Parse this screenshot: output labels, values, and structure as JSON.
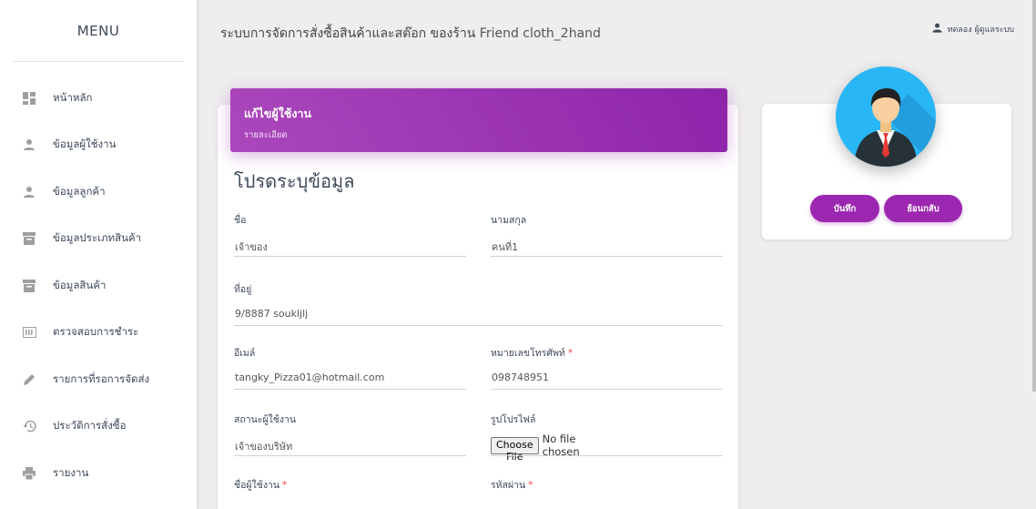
{
  "sidebar": {
    "logo": "MENU",
    "items": [
      {
        "label": "หน้าหลัก",
        "icon": "dashboard-icon"
      },
      {
        "label": "ข้อมูลผู้ใช้งาน",
        "icon": "person-icon"
      },
      {
        "label": "ข้อมูลลูกค้า",
        "icon": "person-icon"
      },
      {
        "label": "ข้อมูลประเภทสินค้า",
        "icon": "archive-icon"
      },
      {
        "label": "ข้อมูลสินค้า",
        "icon": "archive-icon"
      },
      {
        "label": "ตรวจสอบการชำระ",
        "icon": "payment-icon"
      },
      {
        "label": "รายการที่รอการจัดส่ง",
        "icon": "pencil-icon"
      },
      {
        "label": "ประวัติการสั่งซื้อ",
        "icon": "history-icon"
      },
      {
        "label": "รายงาน",
        "icon": "printer-icon"
      }
    ]
  },
  "topbar": {
    "title": "ระบบการจัดการสั่งซื้อสินค้าและสต๊อก ของร้าน",
    "shop_name": "Friend cloth_2hand",
    "user_label": "ทดลอง ผู้ดูแลระบบ"
  },
  "card": {
    "title": "แก้ไขผู้ใช้งาน",
    "subtitle": "รายละเอียด",
    "form_heading": "โปรดระบุข้อมูล"
  },
  "form": {
    "first_name": {
      "label": "ชื่อ",
      "value": "เจ้าของ"
    },
    "last_name": {
      "label": "นามสกุล",
      "value": "คนที่1"
    },
    "address": {
      "label": "ที่อยู่",
      "value": "9/8887 soukljlj"
    },
    "email": {
      "label": "อีเมล์",
      "value": "tangky_Pizza01@hotmail.com"
    },
    "phone": {
      "label": "หมายเลขโทรศัพท์",
      "required": "*",
      "value": "098748951"
    },
    "status": {
      "label": "สถานะผู้ใช้งาน",
      "value": "เจ้าของบริษัท"
    },
    "profile_picture": {
      "label": "รูปโปรไฟล์",
      "button": "Choose File",
      "status": "No file chosen"
    },
    "username": {
      "label": "ชื่อผู้ใช้งาน",
      "required": "*"
    },
    "password": {
      "label": "รหัสผ่าน",
      "required": "*"
    }
  },
  "side": {
    "save_label": "บันทึก",
    "back_label": "ย้อนกลับ"
  },
  "colors": {
    "accent": "#9c27b0",
    "avatar_bg": "#29b6f6",
    "required": "#f44336"
  }
}
